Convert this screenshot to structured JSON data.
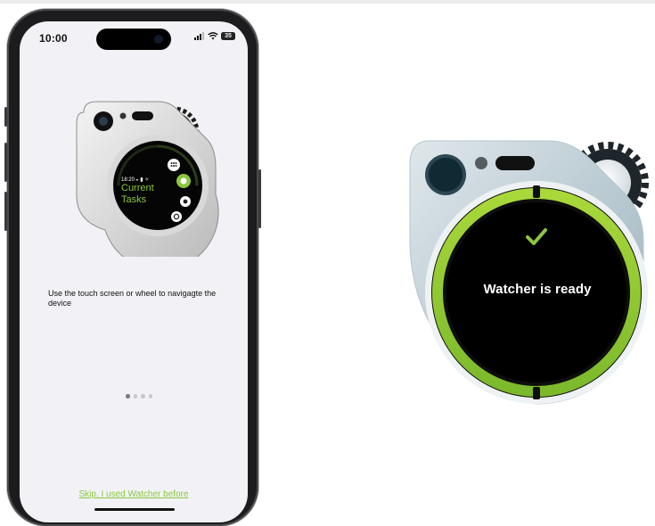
{
  "phone": {
    "status_bar": {
      "time": "10:00",
      "battery": "35"
    },
    "device_screen": {
      "time": "18:20",
      "title_line1": "Current",
      "title_line2": "Tasks"
    },
    "instruction": "Use the touch screen or wheel to navigagte the device",
    "pagination": {
      "count": 4,
      "active_index": 0
    },
    "skip_link": "Skip. I used Watcher before"
  },
  "device": {
    "status_text": "Watcher is ready",
    "check_icon": "check-icon"
  },
  "colors": {
    "accent_green": "#8cc63f",
    "screen_bg": "#f2f2f6"
  }
}
